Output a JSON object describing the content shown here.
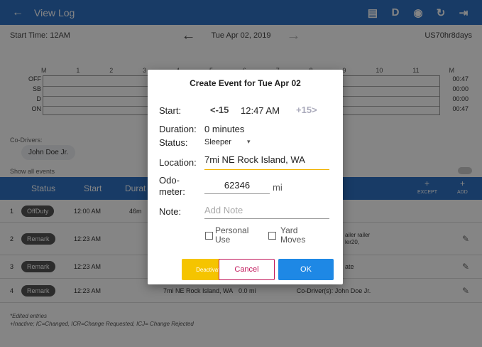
{
  "topbar": {
    "back_icon": "arrow-left-icon",
    "title": "View Log",
    "d_label": "D"
  },
  "subbar": {
    "start_time": "Start Time: 12AM",
    "date": "Tue Apr 02, 2019",
    "ruleset": "US70hr8days"
  },
  "graph": {
    "hours": [
      "M",
      "1",
      "2",
      "3",
      "4",
      "5",
      "6",
      "7",
      "8",
      "9",
      "10",
      "11",
      "M"
    ],
    "rows": [
      "OFF",
      "SB",
      "D",
      "ON"
    ],
    "totals": [
      "00:47",
      "00:00",
      "00:00",
      "00:47"
    ]
  },
  "codrivers": {
    "label": "Co-Drivers:",
    "name": "John Doe Jr."
  },
  "show_all": "Show all events",
  "table": {
    "headers": {
      "status": "Status",
      "start": "Start",
      "duration": "Durat",
      "except": "EXCEPT",
      "add": "ADD",
      "plus": "+"
    },
    "rows": [
      {
        "num": "1",
        "status": "OffDuty",
        "time": "12:00 AM",
        "dur": "46m"
      },
      {
        "num": "2",
        "status": "Remark",
        "time": "12:23 AM",
        "note": "ailer railer ler20,"
      },
      {
        "num": "3",
        "status": "Remark",
        "time": "12:23 AM",
        "note": "ate"
      },
      {
        "num": "4",
        "status": "Remark",
        "time": "12:23 AM",
        "location": "7mi NE Rock Island, WA",
        "odo": "0.0 mi",
        "note": "Co-Driver(s): John Doe Jr."
      }
    ]
  },
  "footer": {
    "line1": "*Edited entries",
    "line2": "+Inactive; IC=Changed, ICR=Change Requested, ICJ= Change Rejected"
  },
  "dialog": {
    "title": "Create Event for Tue Apr 02",
    "start_label": "Start:",
    "minus15": "<-15",
    "start_time": "12:47 AM",
    "plus15": "+15>",
    "duration_label": "Duration:",
    "duration_value": "0 minutes",
    "status_label": "Status:",
    "status_value": "Sleeper",
    "location_label": "Location:",
    "location_value": "7mi NE Rock Island, WA",
    "odo_label_1": "Odo-",
    "odo_label_2": "meter:",
    "odo_value": "62346",
    "odo_unit": "mi",
    "note_label": "Note:",
    "note_placeholder": "Add Note",
    "personal_use_1": "Personal",
    "personal_use_2": "Use",
    "yard_moves_1": "Yard",
    "yard_moves_2": "Moves",
    "deactivate": "Deactivate",
    "cancel": "Cancel",
    "ok": "OK"
  },
  "colors": {
    "primary": "#2f72c4",
    "accent_yellow": "#f5c400",
    "cancel_red": "#c2185b",
    "ok_blue": "#1e88e5"
  }
}
